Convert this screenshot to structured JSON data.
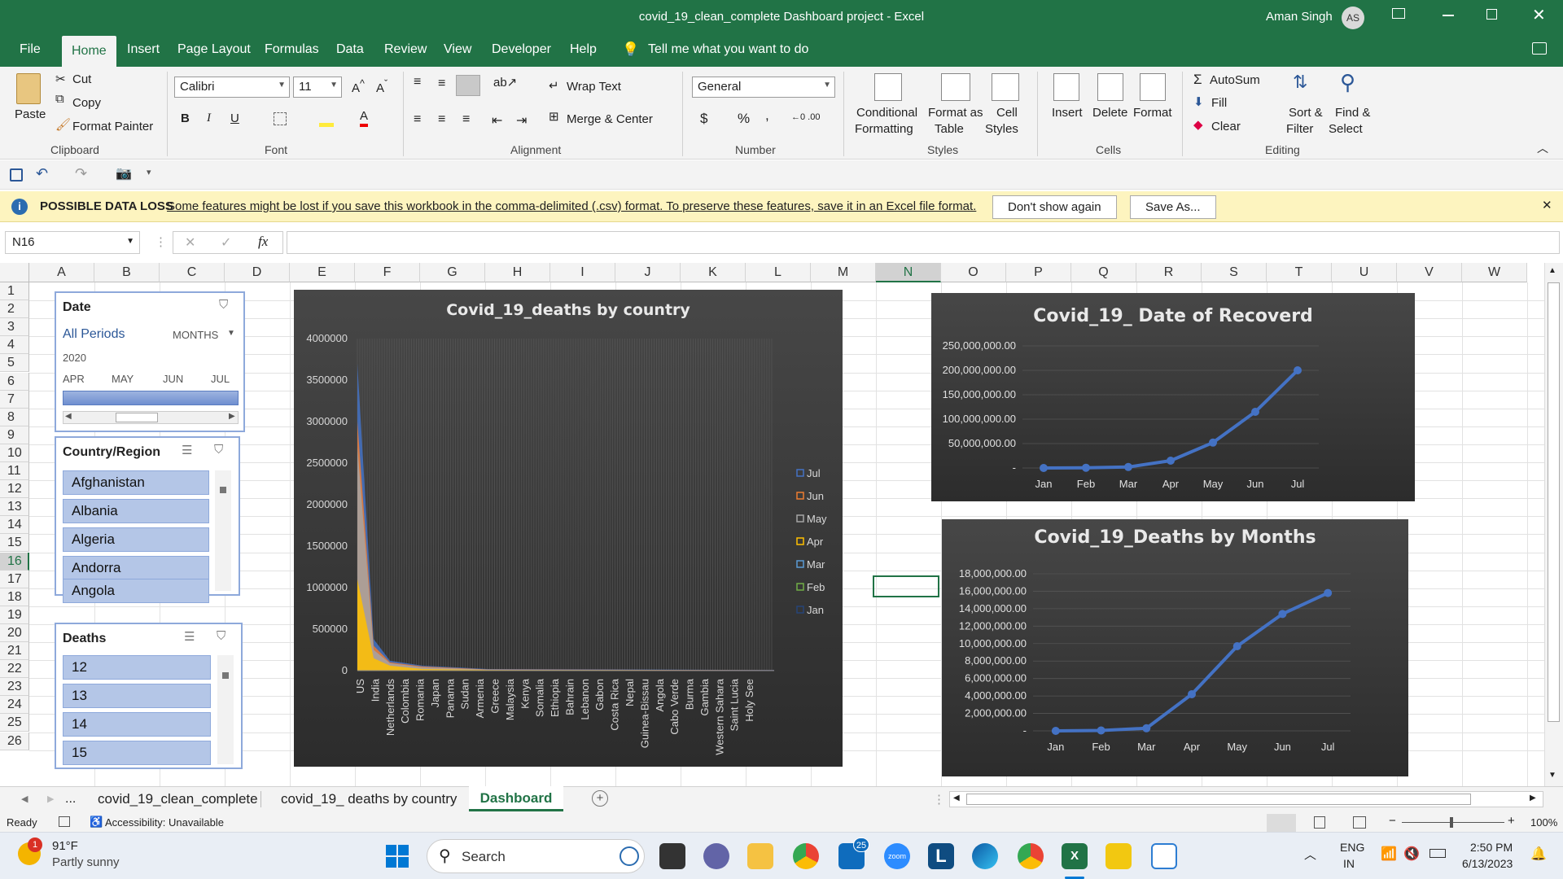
{
  "titlebar": {
    "title": "covid_19_clean_complete Dashboard project  -  Excel",
    "user": "Aman Singh",
    "initials": "AS"
  },
  "menu": [
    "File",
    "Home",
    "Insert",
    "Page Layout",
    "Formulas",
    "Data",
    "Review",
    "View",
    "Developer",
    "Help"
  ],
  "tell_me": "Tell me what you want to do",
  "ribbon": {
    "paste": "Paste",
    "cut": "Cut",
    "copy": "Copy",
    "format_painter": "Format Painter",
    "clipboard": "Clipboard",
    "font_name": "Calibri",
    "font_size": "11",
    "font": "Font",
    "wrap_text": "Wrap Text",
    "merge_center": "Merge & Center",
    "alignment": "Alignment",
    "number_format": "General",
    "number": "Number",
    "cond_format_1": "Conditional",
    "cond_format_2": "Formatting",
    "format_table_1": "Format as",
    "format_table_2": "Table",
    "cell_styles_1": "Cell",
    "cell_styles_2": "Styles",
    "styles": "Styles",
    "insert": "Insert",
    "delete": "Delete",
    "format": "Format",
    "cells": "Cells",
    "autosum": "AutoSum",
    "fill": "Fill",
    "clear": "Clear",
    "sort_1": "Sort &",
    "sort_2": "Filter",
    "find_1": "Find &",
    "find_2": "Select",
    "editing": "Editing"
  },
  "infobar": {
    "title": "POSSIBLE DATA LOSS",
    "message": "Some features might be lost if you save this workbook in the comma-delimited (.csv) format. To preserve these features, save it in an Excel file format.",
    "dont_show": "Don't show again",
    "save_as": "Save As..."
  },
  "namebox": "N16",
  "columns": [
    "A",
    "B",
    "C",
    "D",
    "E",
    "F",
    "G",
    "H",
    "I",
    "J",
    "K",
    "L",
    "M",
    "N",
    "O",
    "P",
    "Q",
    "R",
    "S",
    "T",
    "U",
    "V",
    "W"
  ],
  "rows": [
    "1",
    "2",
    "3",
    "4",
    "5",
    "6",
    "7",
    "8",
    "9",
    "10",
    "11",
    "12",
    "13",
    "14",
    "15",
    "16",
    "17",
    "18",
    "19",
    "20",
    "21",
    "22",
    "23",
    "24",
    "25",
    "26"
  ],
  "slicer_date": {
    "title": "Date",
    "periods": "All Periods",
    "level": "MONTHS",
    "year": "2020",
    "months": [
      "APR",
      "MAY",
      "JUN",
      "JUL"
    ]
  },
  "slicer_country": {
    "title": "Country/Region",
    "items": [
      "Afghanistan",
      "Albania",
      "Algeria",
      "Andorra",
      "Angola"
    ]
  },
  "slicer_deaths": {
    "title": "Deaths",
    "items": [
      "12",
      "13",
      "14",
      "15"
    ]
  },
  "chart_data": [
    {
      "type": "area",
      "title": "Covid_19_deaths by country",
      "yticks": [
        "4000000",
        "3500000",
        "3000000",
        "2500000",
        "2000000",
        "1500000",
        "1000000",
        "500000",
        "0"
      ],
      "ylim": [
        0,
        4000000
      ],
      "categories": [
        "US",
        "India",
        "Netherlands",
        "Colombia",
        "Romania",
        "Japan",
        "Panama",
        "Sudan",
        "Armenia",
        "Greece",
        "Malaysia",
        "Kenya",
        "Somalia",
        "Ethiopia",
        "Bahrain",
        "Lebanon",
        "Gabon",
        "Costa Rica",
        "Nepal",
        "Guinea-Bissau",
        "Angola",
        "Cabo Verde",
        "Burma",
        "Gambia",
        "Western Sahara",
        "Saint Lucia",
        "Holy See"
      ],
      "legend": [
        "Jul",
        "Jun",
        "May",
        "Apr",
        "Mar",
        "Feb",
        "Jan"
      ],
      "legend_colors": [
        "#4472c4",
        "#ed7d31",
        "#a5a5a5",
        "#ffc000",
        "#5b9bd5",
        "#70ad47",
        "#264478"
      ],
      "series_peaks": [
        {
          "name": "Jul",
          "values": [
            3700000,
            380000,
            120000,
            60000,
            20000,
            8000
          ]
        },
        {
          "name": "Jun",
          "values": [
            3000000,
            300000,
            100000,
            50000,
            15000,
            6000
          ]
        },
        {
          "name": "May",
          "values": [
            2700000,
            250000,
            90000,
            40000,
            12000,
            5000
          ]
        },
        {
          "name": "Apr",
          "values": [
            1100000,
            150000,
            60000,
            20000,
            8000,
            3000
          ]
        }
      ]
    },
    {
      "type": "line",
      "title": "Covid_19_ Date of Recoverd",
      "categories": [
        "Jan",
        "Feb",
        "Mar",
        "Apr",
        "May",
        "Jun",
        "Jul"
      ],
      "values": [
        0,
        500000,
        2000000,
        15000000,
        52000000,
        115000000,
        200000000
      ],
      "yticks": [
        "250,000,000.00",
        "200,000,000.00",
        "150,000,000.00",
        "100,000,000.00",
        "50,000,000.00",
        "-"
      ],
      "ylim": [
        0,
        250000000
      ]
    },
    {
      "type": "line",
      "title": "Covid_19_Deaths by Months",
      "categories": [
        "Jan",
        "Feb",
        "Mar",
        "Apr",
        "May",
        "Jun",
        "Jul"
      ],
      "values": [
        0,
        50000,
        300000,
        4200000,
        9700000,
        13400000,
        15800000
      ],
      "yticks": [
        "18,000,000.00",
        "16,000,000.00",
        "14,000,000.00",
        "12,000,000.00",
        "10,000,000.00",
        "8,000,000.00",
        "6,000,000.00",
        "4,000,000.00",
        "2,000,000.00",
        "-"
      ],
      "ylim": [
        0,
        18000000
      ]
    }
  ],
  "sheet_tabs": [
    "covid_19_clean_complete",
    "covid_19_ deaths by country",
    "Dashboard"
  ],
  "sheet_ellipsis": "...",
  "status": {
    "ready": "Ready",
    "accessibility": "Accessibility: Unavailable",
    "zoom": "100%"
  },
  "taskbar": {
    "temp": "91°F",
    "weather": "Partly sunny",
    "search": "Search",
    "lang_1": "ENG",
    "lang_2": "IN",
    "time": "2:50 PM",
    "date": "6/13/2023",
    "mail_badge": "25",
    "weather_badge": "1",
    "zoom_label": "zoom"
  },
  "colors": {
    "excel_green": "#217346",
    "slicer_item": "#b4c6e7",
    "line": "#4472c4"
  }
}
